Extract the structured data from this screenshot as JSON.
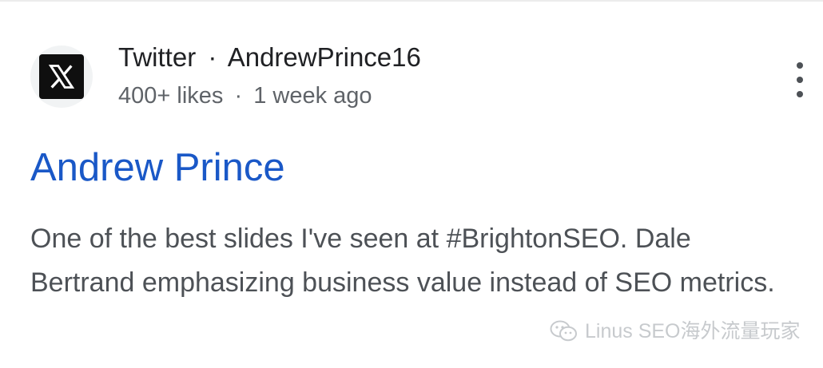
{
  "result": {
    "site_name": "Twitter",
    "separator": "·",
    "handle": "AndrewPrince16",
    "likes": "400+ likes",
    "age": "1 week ago",
    "title": "Andrew Prince",
    "snippet": "One of the best slides I've seen at #BrightonSEO. Dale Bertrand emphasizing business value instead of SEO metrics.",
    "favicon_icon": "x-logo-icon",
    "menu_icon": "more-vert-icon"
  },
  "watermark": {
    "text": "Linus SEO海外流量玩家",
    "icon": "wechat-icon"
  },
  "colors": {
    "title_link": "#1a58c7",
    "snippet_text": "#4d5156",
    "meta_text": "#5f6368",
    "source_text": "#202124"
  }
}
